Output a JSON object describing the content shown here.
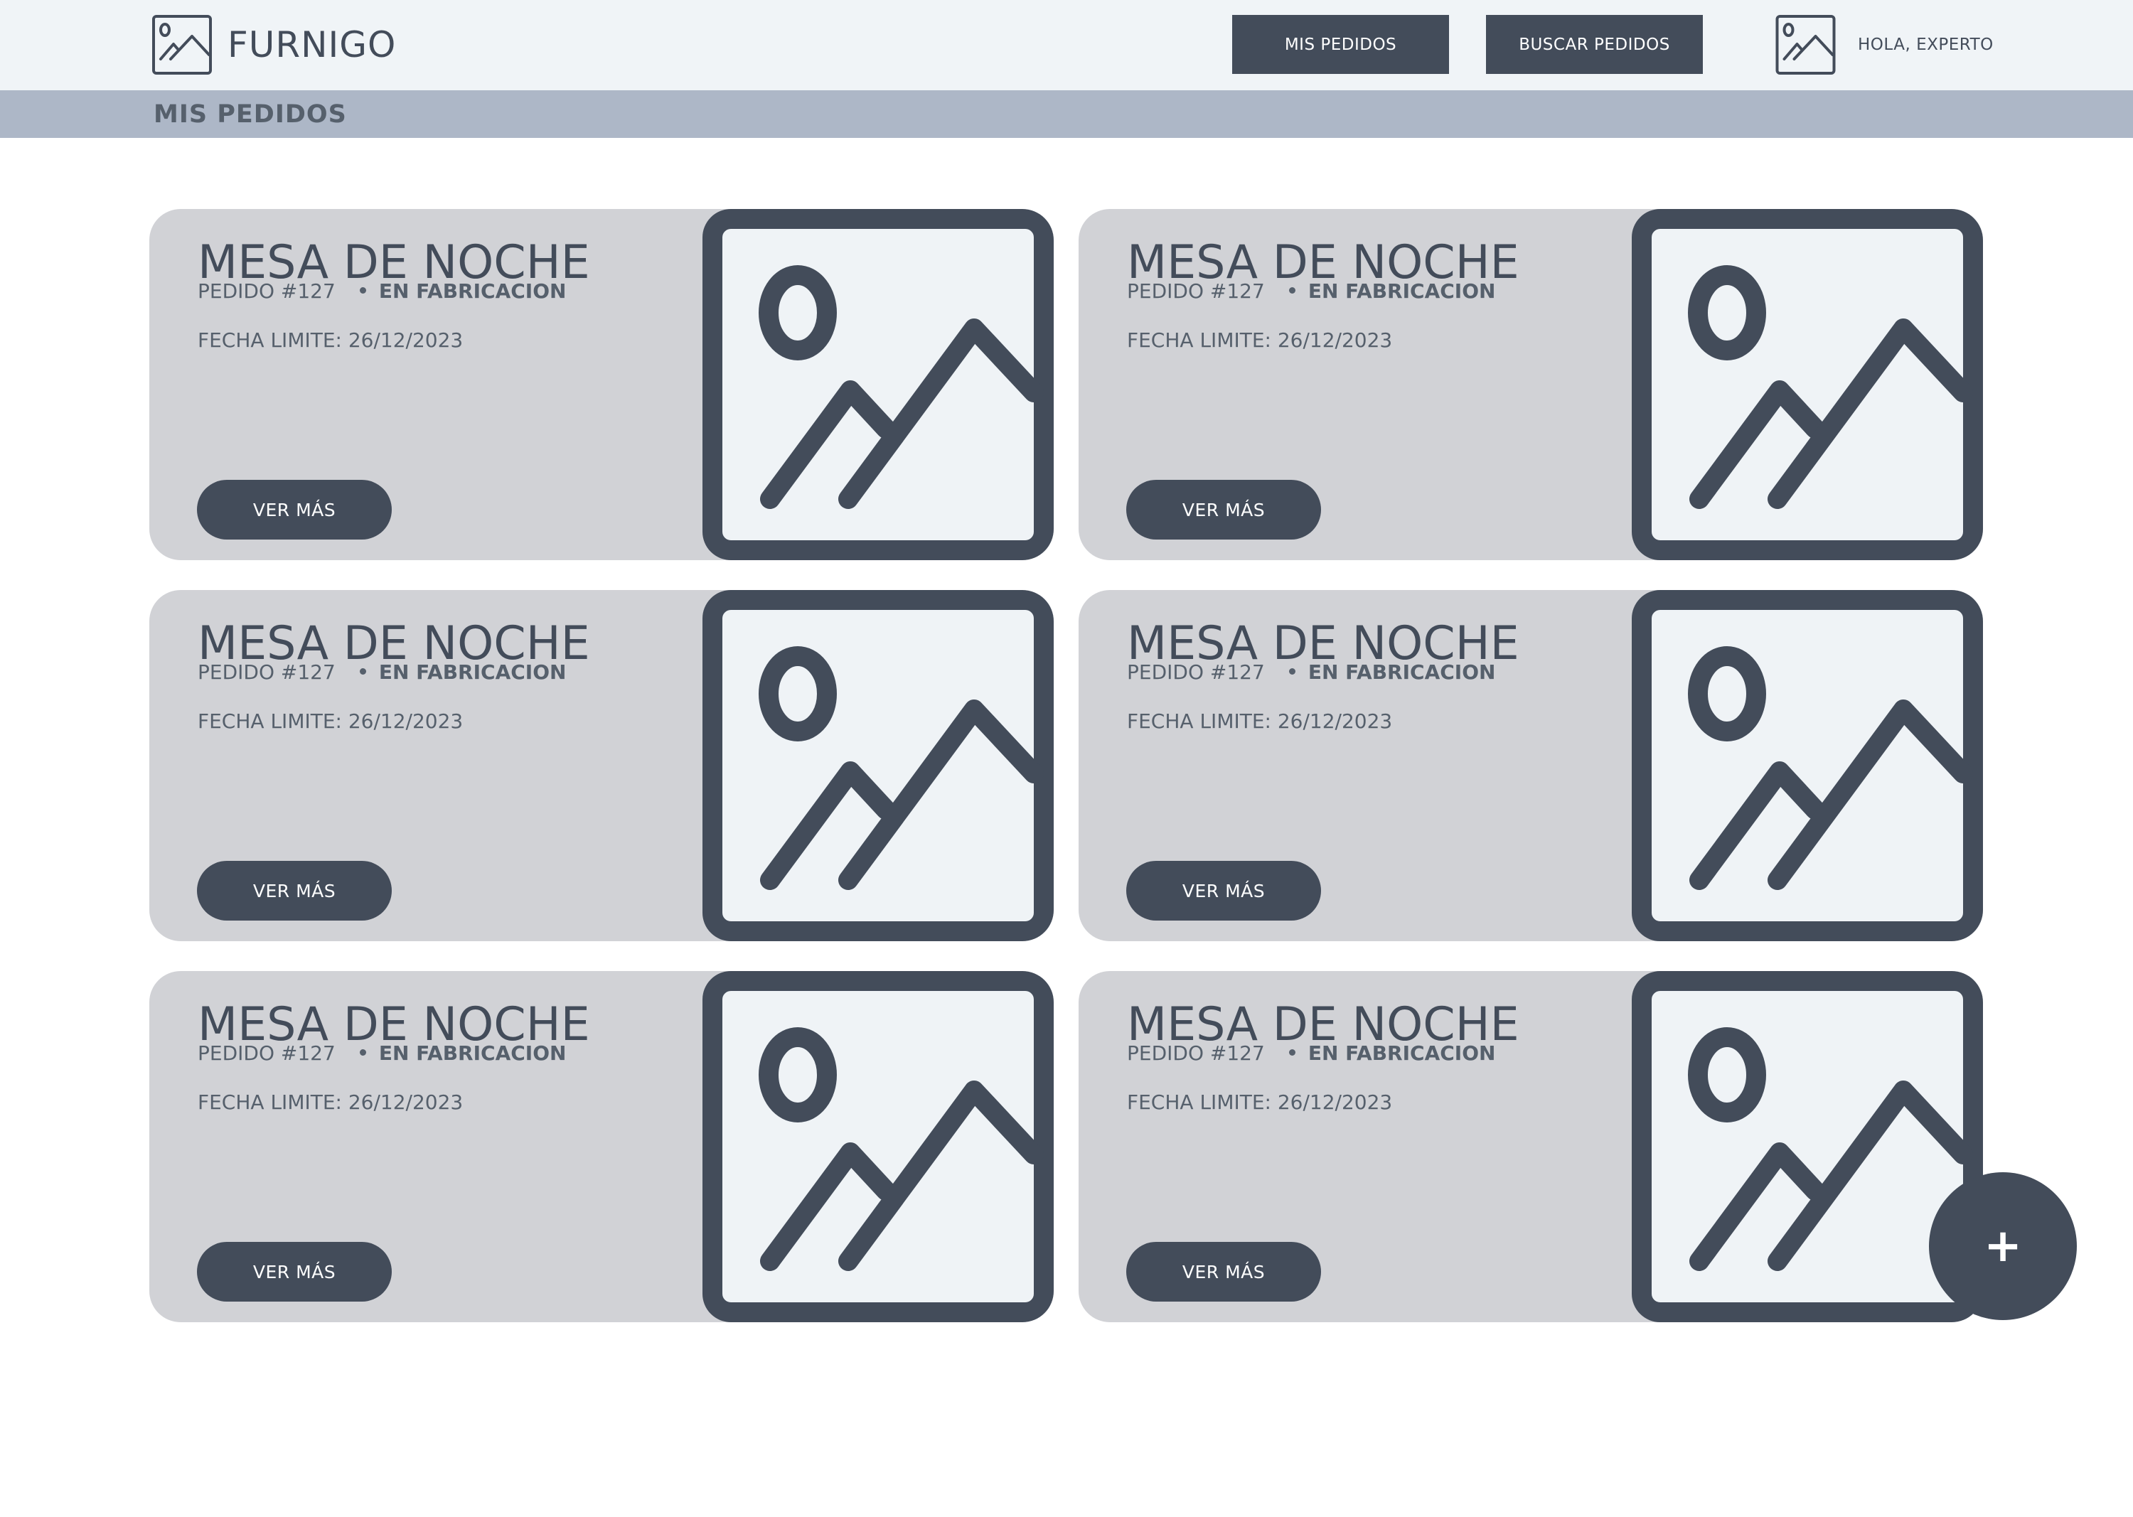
{
  "app": {
    "brand": "FURNIGO",
    "logo_icon": "image-placeholder-icon"
  },
  "nav": {
    "my_orders_label": "MIS PEDIDOS",
    "search_orders_label": "BUSCAR PEDIDOS",
    "greeting": "HOLA, EXPERTO",
    "avatar_icon": "image-placeholder-icon"
  },
  "page": {
    "title": "MIS PEDIDOS"
  },
  "orders": [
    {
      "title": "MESA DE NOCHE",
      "order_number": "PEDIDO #127",
      "status": "EN FABRICACION",
      "due_date": "FECHA LIMITE: 26/12/2023",
      "action_label": "VER MÁS",
      "image_icon": "image-placeholder-icon"
    },
    {
      "title": "MESA DE NOCHE",
      "order_number": "PEDIDO #127",
      "status": "EN FABRICACION",
      "due_date": "FECHA LIMITE: 26/12/2023",
      "action_label": "VER MÁS",
      "image_icon": "image-placeholder-icon"
    },
    {
      "title": "MESA DE NOCHE",
      "order_number": "PEDIDO #127",
      "status": "EN FABRICACION",
      "due_date": "FECHA LIMITE: 26/12/2023",
      "action_label": "VER MÁS",
      "image_icon": "image-placeholder-icon"
    },
    {
      "title": "MESA DE NOCHE",
      "order_number": "PEDIDO #127",
      "status": "EN FABRICACION",
      "due_date": "FECHA LIMITE: 26/12/2023",
      "action_label": "VER MÁS",
      "image_icon": "image-placeholder-icon"
    },
    {
      "title": "MESA DE NOCHE",
      "order_number": "PEDIDO #127",
      "status": "EN FABRICACION",
      "due_date": "FECHA LIMITE: 26/12/2023",
      "action_label": "VER MÁS",
      "image_icon": "image-placeholder-icon"
    },
    {
      "title": "MESA DE NOCHE",
      "order_number": "PEDIDO #127",
      "status": "EN FABRICACION",
      "due_date": "FECHA LIMITE: 26/12/2023",
      "action_label": "VER MÁS",
      "image_icon": "image-placeholder-icon"
    }
  ],
  "fab": {
    "label": "+",
    "icon": "plus-icon"
  },
  "colors": {
    "header_bg": "#f0f4f7",
    "subheader_bg": "#adb7c7",
    "card_bg": "#d1d2d6",
    "primary": "#434c5a",
    "image_bg": "#eff3f6"
  }
}
